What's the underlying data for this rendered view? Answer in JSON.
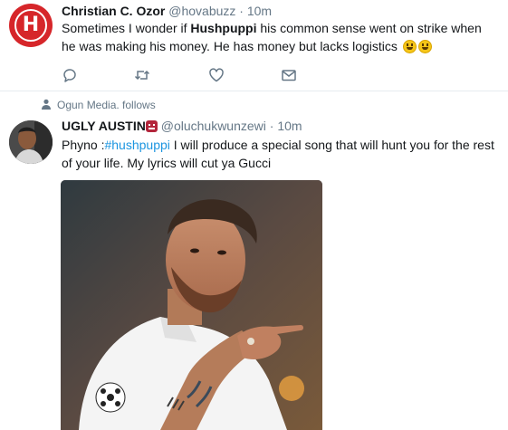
{
  "tweets": [
    {
      "avatar_letter": "H",
      "author_name": "Christian C. Ozor",
      "handle": "@hovabuzz",
      "separator": "·",
      "time": "10m",
      "text_part1": "Sometimes I wonder if ",
      "text_bold": "Hushpuppi",
      "text_part2": " his common sense went on strike when he was making his money. He has money but lacks logistics",
      "actions": [
        "reply-icon",
        "retweet-icon",
        "like-icon",
        "direct-message-icon"
      ]
    },
    {
      "social_context": "Ogun Media. follows",
      "author_name": "UGLY AUSTIN",
      "handle": "@oluchukwunzewi",
      "separator": "·",
      "time": "10m",
      "text_part1": "Phyno :",
      "hashtag": "#hushpuppi",
      "text_part2": " I will produce a special song that will hunt you for the rest of your life. My lyrics will cut ya Gucci"
    }
  ],
  "colors": {
    "accent": "#1b95e0",
    "secondary_text": "#657786",
    "avatar_red": "#d6262a"
  }
}
